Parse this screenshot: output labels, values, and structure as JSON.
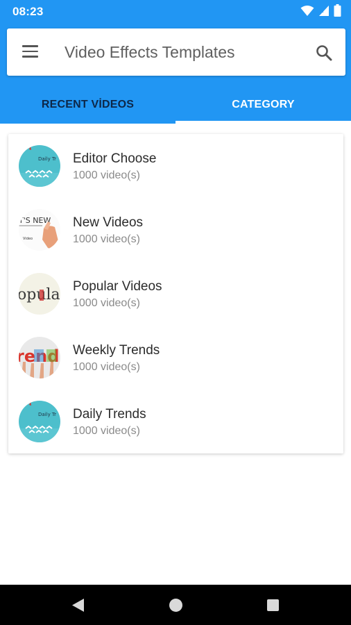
{
  "status_bar": {
    "time": "08:23"
  },
  "toolbar": {
    "title": "Video Effects Templates"
  },
  "tabs": [
    {
      "label": "RECENT VİDEOS",
      "selected": false
    },
    {
      "label": "CATEGORY",
      "selected": true
    }
  ],
  "categories": [
    {
      "title": "Editor Choose",
      "count": "1000 video(s)",
      "thumb_text": "Daily Tr"
    },
    {
      "title": "New Videos",
      "count": "1000 video(s)",
      "thumb_text": "T'S NEW"
    },
    {
      "title": "Popular Videos",
      "count": "1000 video(s)",
      "thumb_text": "opula"
    },
    {
      "title": "Weekly Trends",
      "count": "1000 video(s)",
      "thumb_text": "rend"
    },
    {
      "title": "Daily Trends",
      "count": "1000 video(s)",
      "thumb_text": "Daily Tr"
    }
  ],
  "colors": {
    "primary": "#2196f3",
    "tab_inactive": "#0d2748",
    "tab_active": "#ffffff",
    "teal_thumb": "#4dbfcc"
  },
  "icons": {
    "menu": "menu-icon",
    "search": "search-icon",
    "wifi": "wifi-icon",
    "signal": "signal-icon",
    "battery": "battery-icon",
    "back": "back-icon",
    "home": "home-icon",
    "recents": "recents-icon"
  }
}
